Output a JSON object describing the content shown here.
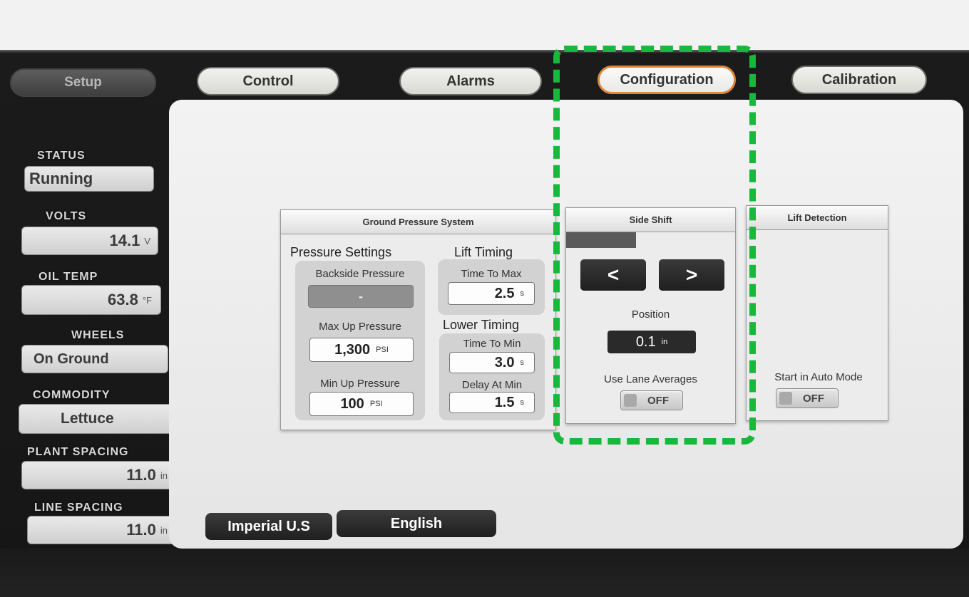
{
  "tabs": {
    "setup": "Setup",
    "control": "Control",
    "alarms": "Alarms",
    "configuration": "Configuration",
    "calibration": "Calibration",
    "active": "Configuration"
  },
  "sidebar": {
    "status": {
      "label": "STATUS",
      "value": "Running"
    },
    "volts": {
      "label": "VOLTS",
      "value": "14.1",
      "unit": "V"
    },
    "oil_temp": {
      "label": "OIL TEMP",
      "value": "63.8",
      "unit": "°F"
    },
    "wheels": {
      "label": "WHEELS",
      "value": "On Ground"
    },
    "commodity": {
      "label": "COMMODITY",
      "value": "Lettuce"
    },
    "plant_spacing": {
      "label": "PLANT SPACING",
      "value": "11.0",
      "unit": "in"
    },
    "line_spacing": {
      "label": "LINE SPACING",
      "value": "11.0",
      "unit": "in"
    }
  },
  "ground_pressure": {
    "title": "Ground Pressure System",
    "pressure_settings": "Pressure Settings",
    "backside_pressure": {
      "label": "Backside Pressure",
      "value": "-"
    },
    "max_up_pressure": {
      "label": "Max Up Pressure",
      "value": "1,300",
      "unit": "PSI"
    },
    "min_up_pressure": {
      "label": "Min Up Pressure",
      "value": "100",
      "unit": "PSI"
    },
    "lift_timing": "Lift Timing",
    "time_to_max": {
      "label": "Time To Max",
      "value": "2.5",
      "unit": "s"
    },
    "lower_timing": "Lower Timing",
    "time_to_min": {
      "label": "Time To Min",
      "value": "3.0",
      "unit": "s"
    },
    "delay_at_min": {
      "label": "Delay At Min",
      "value": "1.5",
      "unit": "s"
    }
  },
  "side_shift": {
    "title": "Side Shift",
    "left_button": "<",
    "right_button": ">",
    "position_label": "Position",
    "position_value": "0.1",
    "position_unit": "in",
    "lane_averages_label": "Use Lane Averages",
    "lane_averages_state": "OFF"
  },
  "lift_detection": {
    "title": "Lift Detection",
    "auto_mode_label": "Start in Auto Mode",
    "auto_mode_state": "OFF"
  },
  "footer": {
    "units": "Imperial U.S",
    "language": "English"
  },
  "colors": {
    "active_tab_border": "#e0883a",
    "highlight": "#18b83c",
    "panel_bg": "#ececec",
    "dark_button": "#1e1e1e"
  }
}
